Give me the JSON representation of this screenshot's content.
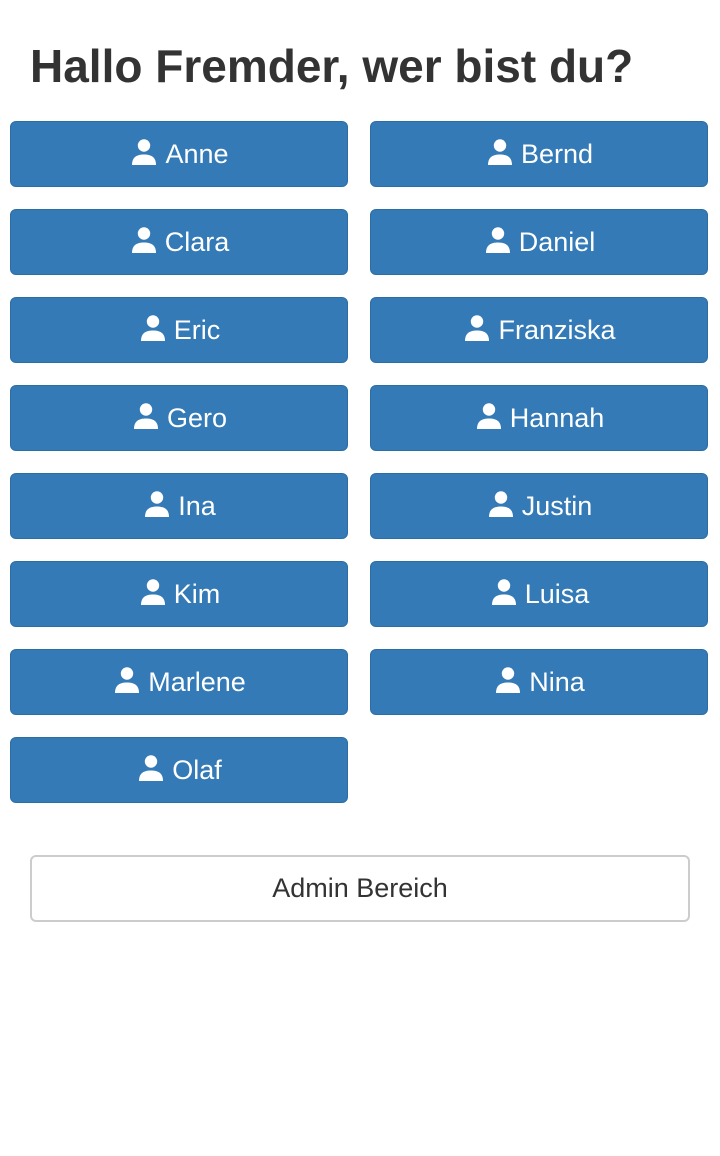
{
  "header": {
    "title": "Hallo Fremder, wer bist du?"
  },
  "users": [
    {
      "label": "Anne"
    },
    {
      "label": "Bernd"
    },
    {
      "label": "Clara"
    },
    {
      "label": "Daniel"
    },
    {
      "label": "Eric"
    },
    {
      "label": "Franziska"
    },
    {
      "label": "Gero"
    },
    {
      "label": "Hannah"
    },
    {
      "label": "Ina"
    },
    {
      "label": "Justin"
    },
    {
      "label": "Kim"
    },
    {
      "label": "Luisa"
    },
    {
      "label": "Marlene"
    },
    {
      "label": "Nina"
    },
    {
      "label": "Olaf"
    }
  ],
  "admin": {
    "label": "Admin Bereich"
  },
  "icons": {
    "user_icon": "user-icon"
  },
  "colors": {
    "primary": "#337ab7",
    "primary_border": "#2e6da4",
    "text": "#333333",
    "admin_border": "#cccccc"
  }
}
